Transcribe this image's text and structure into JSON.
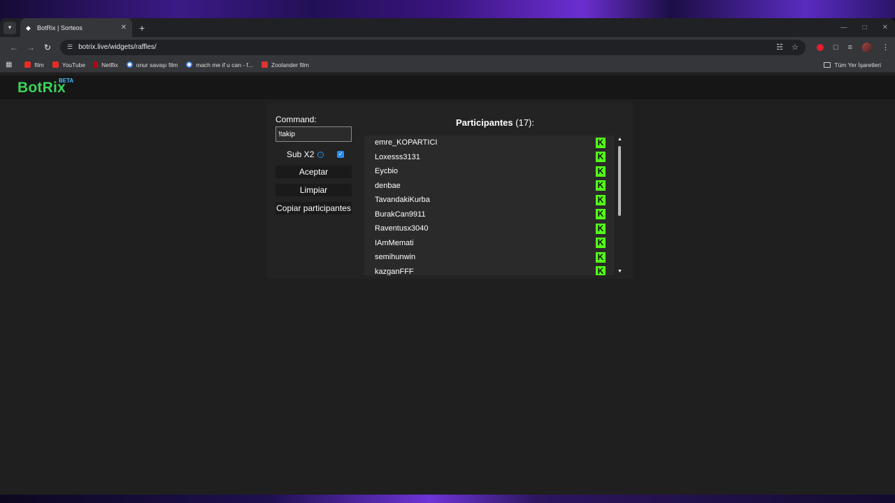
{
  "browser": {
    "tab_title": "BotRix | Sorteos",
    "url": "botrix.live/widgets/raffles/",
    "bookmarks": [
      {
        "label": "film",
        "icon": "youtube-icon"
      },
      {
        "label": "YouTube",
        "icon": "youtube-icon"
      },
      {
        "label": "Netflix",
        "icon": "netflix-icon"
      },
      {
        "label": "onur savaşı film",
        "icon": "google-icon"
      },
      {
        "label": "mach me if u can - f...",
        "icon": "google-icon"
      },
      {
        "label": "Zoolander film",
        "icon": "zoolander-icon"
      }
    ],
    "all_bookmarks": "Tüm Yer İşaretleri"
  },
  "header": {
    "logo": "BotRix",
    "logo_badge": "BETA"
  },
  "raffle": {
    "command_label": "Command:",
    "command_value": "!takip",
    "sub_label": "Sub X2",
    "sub_checked": true,
    "accept_label": "Aceptar",
    "clear_label": "Limpiar",
    "copy_label": "Copiar participantes",
    "participants_title": "Participantes",
    "participants_count": "(17):",
    "participants": [
      "emre_KOPARTICI",
      "Loxesss3131",
      "Eycbio",
      "denbae",
      "TavandakiKurba",
      "BurakCan9911",
      "Raventusx3040",
      "IAmMemati",
      "semihunwin",
      "kazganFFF"
    ],
    "platform_icon": "kick-icon"
  },
  "colors": {
    "brand": "#3cd35a",
    "beta": "#46c1ff",
    "kick": "#53fc18",
    "checkbox": "#2a8cf0"
  }
}
